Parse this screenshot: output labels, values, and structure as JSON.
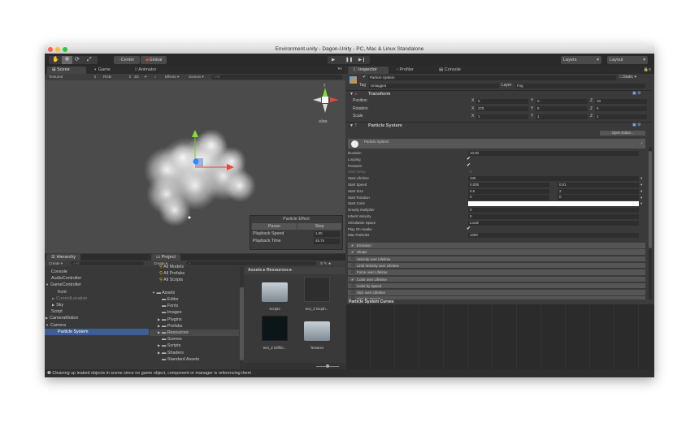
{
  "window": {
    "title": "Environment.unity - Dagon-Unity - PC, Mac & Linux Standalone"
  },
  "toolbar": {
    "pivot": "Center",
    "space": "Global",
    "layers": "Layers",
    "layout": "Layout"
  },
  "scene": {
    "tabs": [
      "Scene",
      "Game",
      "Animator"
    ],
    "shading": "Textured",
    "render_mode": "RGB",
    "mode_2d": "2D",
    "effects": "Effects",
    "gizmos": "Gizmos",
    "search_placeholder": "All",
    "gizmo_y": "y",
    "iso": "Iso"
  },
  "particle_effect": {
    "title": "Particle Effect",
    "pause": "Pause",
    "stop": "Stop",
    "speed_label": "Playback Speed",
    "speed": "1.00",
    "time_label": "Playback Time",
    "time": "45.74"
  },
  "inspector": {
    "tabs": [
      "Inspector",
      "Profiler",
      "Console"
    ],
    "object_name": "Particle System",
    "static": "Static",
    "tag_label": "Tag",
    "tag": "Untagged",
    "layer_label": "Layer",
    "layer": "Fog",
    "transform": {
      "title": "Transform",
      "rows": [
        {
          "label": "Position",
          "x": "0",
          "y": "0",
          "z": "10"
        },
        {
          "label": "Rotation",
          "x": "270",
          "y": "0",
          "z": "0"
        },
        {
          "label": "Scale",
          "x": "1",
          "y": "1",
          "z": "1"
        }
      ]
    },
    "axis": [
      "X",
      "Y",
      "Z"
    ],
    "ps_title": "Particle System",
    "open_editor": "Open Editor...",
    "ps_sub": "Particle System",
    "props": [
      {
        "label": "Duration",
        "v1": "10.00"
      },
      {
        "label": "Looping",
        "check": true
      },
      {
        "label": "Prewarm",
        "check": true
      },
      {
        "label": "Start Delay",
        "v1": "0",
        "disabled": true
      },
      {
        "label": "Start Lifetime",
        "v1": "100"
      },
      {
        "label": "Start Speed",
        "v1": "0.005",
        "v2": "0.01"
      },
      {
        "label": "Start Size",
        "v1": "0.5",
        "v2": "2"
      },
      {
        "label": "Start Rotation",
        "v1": "0",
        "v2": "0"
      },
      {
        "label": "Start Color",
        "color": "#ffffff"
      },
      {
        "label": "Gravity Multiplier",
        "v1": "0"
      },
      {
        "label": "Inherit Velocity",
        "v1": "0"
      },
      {
        "label": "Simulation Space",
        "v1": "Local"
      },
      {
        "label": "Play On Awake",
        "check": true
      },
      {
        "label": "Max Particles",
        "v1": "1000"
      }
    ],
    "modules": [
      {
        "label": "Emission",
        "on": true
      },
      {
        "label": "Shape",
        "on": true
      },
      {
        "label": "Velocity over Lifetime",
        "on": false
      },
      {
        "label": "Limit Velocity over Lifetime",
        "on": false
      },
      {
        "label": "Force over Lifetime",
        "on": false
      },
      {
        "label": "Color over Lifetime",
        "on": true
      },
      {
        "label": "Color by Speed",
        "on": false
      },
      {
        "label": "Size over Lifetime",
        "on": false
      },
      {
        "label": "Size by Speed",
        "on": false
      }
    ],
    "curves_title": "Particle System Curves"
  },
  "hierarchy": {
    "tab": "Hierarchy",
    "create": "Create",
    "search": "All",
    "items": [
      {
        "label": "Console",
        "indent": 0
      },
      {
        "label": "AudioController",
        "indent": 0
      },
      {
        "label": "GameController",
        "indent": 0,
        "arrow": "▼"
      },
      {
        "label": "front",
        "indent": 1
      },
      {
        "label": "CurrentLocation",
        "indent": 1,
        "arrow": "▶",
        "dim": true
      },
      {
        "label": "Sky",
        "indent": 1,
        "arrow": "▶"
      },
      {
        "label": "Script",
        "indent": 0
      },
      {
        "label": "CameraMotion",
        "indent": 0,
        "arrow": "▶"
      },
      {
        "label": "Camera",
        "indent": 0,
        "arrow": "▼"
      },
      {
        "label": "Particle System",
        "indent": 1,
        "selected": true
      }
    ]
  },
  "project": {
    "tab": "Project",
    "create": "Create",
    "favorites": [
      "All Models",
      "All Prefabs",
      "All Scripts"
    ],
    "root": "Assets",
    "folders": [
      {
        "label": "Editor"
      },
      {
        "label": "Fonts"
      },
      {
        "label": "Images"
      },
      {
        "label": "Plugins",
        "arrow": true
      },
      {
        "label": "Prefabs",
        "arrow": true
      },
      {
        "label": "Resources",
        "arrow": true,
        "selected": true
      },
      {
        "label": "Scenes"
      },
      {
        "label": "Scripts",
        "arrow": true
      },
      {
        "label": "Shaders",
        "arrow": true
      },
      {
        "label": "Standard Assets"
      }
    ],
    "breadcrumb": [
      "Assets",
      "Resources"
    ],
    "assets": [
      {
        "label": "Scripts",
        "kind": "folder"
      },
      {
        "label": "test_Z Depth...",
        "kind": "image"
      },
      {
        "label": "test_Z Diff00...",
        "kind": "dark"
      },
      {
        "label": "Textures",
        "kind": "folder"
      }
    ]
  },
  "status": {
    "message": "Cleaning up leaked objects in scene since no game object, component or manager is referencing them"
  }
}
